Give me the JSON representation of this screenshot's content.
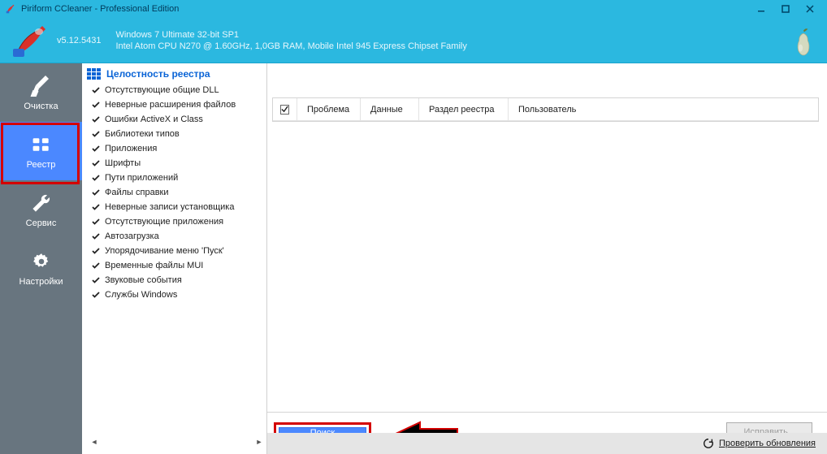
{
  "window": {
    "title": "Piriform CCleaner - Professional Edition"
  },
  "header": {
    "version": "v5.12.5431",
    "sys_line1": "Windows 7 Ultimate 32-bit SP1",
    "sys_line2": "Intel Atom CPU N270 @ 1.60GHz, 1,0GB RAM, Mobile Intel 945 Express Chipset Family"
  },
  "sidebar": {
    "items": [
      {
        "label": "Очистка",
        "icon": "broom-icon"
      },
      {
        "label": "Реестр",
        "icon": "grid-icon",
        "active": true
      },
      {
        "label": "Сервис",
        "icon": "wrench-icon"
      },
      {
        "label": "Настройки",
        "icon": "gear-icon"
      }
    ]
  },
  "registry": {
    "heading": "Целостность реестра",
    "items": [
      "Отсутствующие общие DLL",
      "Неверные расширения файлов",
      "Ошибки ActiveX и Class",
      "Библиотеки типов",
      "Приложения",
      "Шрифты",
      "Пути приложений",
      "Файлы справки",
      "Неверные записи установщика",
      "Отсутствующие приложения",
      "Автозагрузка",
      "Упорядочивание меню 'Пуск'",
      "Временные файлы MUI",
      "Звуковые события",
      "Службы Windows"
    ]
  },
  "table": {
    "columns": [
      "Проблема",
      "Данные",
      "Раздел реестра",
      "Пользователь"
    ]
  },
  "actions": {
    "scan": "Поиск проблем",
    "fix": "Исправить..."
  },
  "status": {
    "check_updates": "Проверить обновления"
  }
}
